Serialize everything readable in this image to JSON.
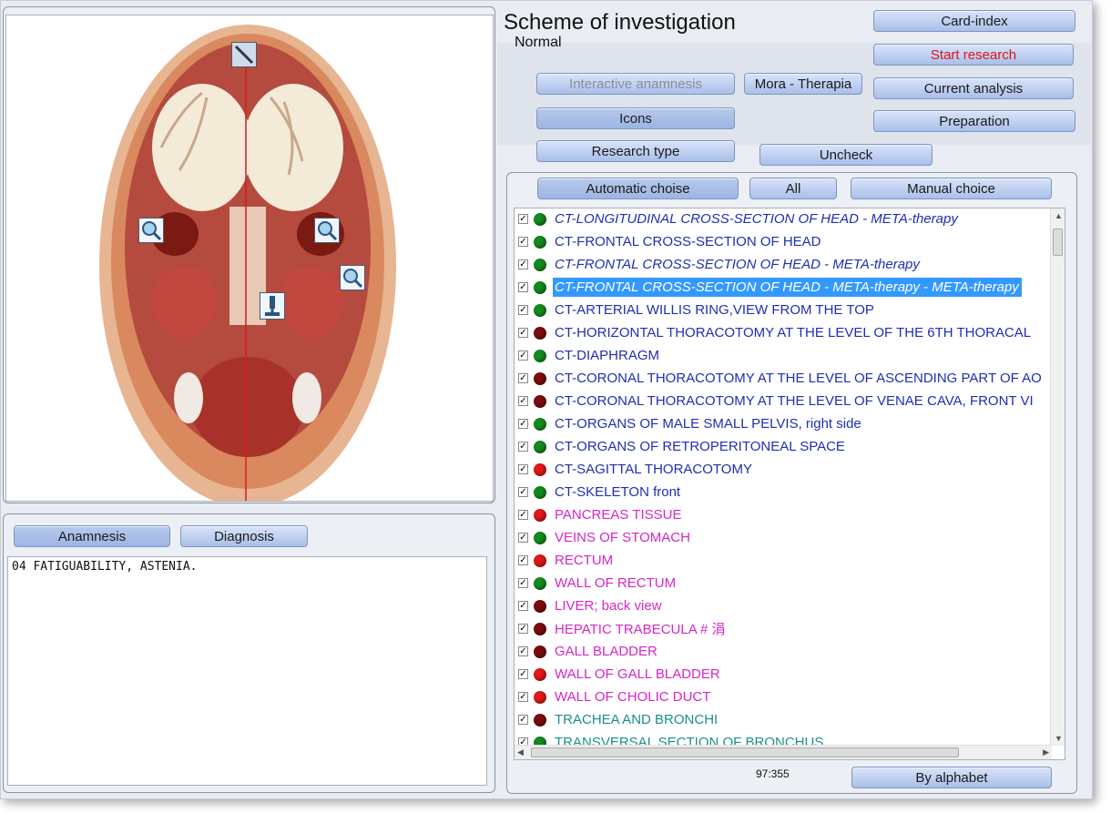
{
  "header": {
    "title": "Scheme of investigation",
    "subtitle": "Normal"
  },
  "buttons": {
    "card_index": "Card-index",
    "start_research": "Start research",
    "current_analysis": "Current analysis",
    "preparation": "Preparation",
    "interactive_anamnesis": "Interactive anamnesis",
    "mora_therapia": "Mora - Therapia",
    "icons": "Icons",
    "research_type": "Research type",
    "uncheck": "Uncheck",
    "automatic_choise": "Automatic choise",
    "all": "All",
    "manual_choice": "Manual choice",
    "by_alphabet": "By alphabet",
    "anamnesis": "Anamnesis",
    "diagnosis": "Diagnosis"
  },
  "counter": "97:355",
  "anamnesis_text": "04  FATIGUABILITY, ASTENIA.",
  "colors": {
    "green": "#138a1d",
    "darkred": "#7a0d0d",
    "red": "#e01818",
    "blue": "#1f2fb0",
    "magenta": "#d626c8",
    "teal": "#1a8f8a"
  },
  "list": [
    {
      "label": "CT-LONGITUDINAL CROSS-SECTION OF HEAD - META-therapy",
      "dot": "green",
      "color": "blue",
      "italic": true
    },
    {
      "label": "CT-FRONTAL CROSS-SECTION OF HEAD",
      "dot": "green",
      "color": "blue",
      "italic": false
    },
    {
      "label": "CT-FRONTAL CROSS-SECTION OF HEAD - META-therapy",
      "dot": "green",
      "color": "blue",
      "italic": true
    },
    {
      "label": "CT-FRONTAL CROSS-SECTION OF HEAD - META-therapy - META-therapy",
      "dot": "green",
      "color": "blue",
      "italic": true,
      "selected": true
    },
    {
      "label": "CT-ARTERIAL WILLIS RING,VIEW FROM THE TOP",
      "dot": "green",
      "color": "blue",
      "italic": false
    },
    {
      "label": "CT-HORIZONTAL THORACOTOMY AT THE LEVEL OF THE 6TH THORACAL",
      "dot": "darkred",
      "color": "blue",
      "italic": false
    },
    {
      "label": "CT-DIAPHRAGM",
      "dot": "green",
      "color": "blue",
      "italic": false
    },
    {
      "label": "CT-CORONAL THORACOTOMY AT THE LEVEL OF ASCENDING PART OF AO",
      "dot": "darkred",
      "color": "blue",
      "italic": false
    },
    {
      "label": "CT-CORONAL THORACOTOMY AT THE LEVEL OF VENAE CAVA, FRONT VI",
      "dot": "darkred",
      "color": "blue",
      "italic": false
    },
    {
      "label": "CT-ORGANS OF MALE SMALL PELVIS, right side",
      "dot": "green",
      "color": "blue",
      "italic": false
    },
    {
      "label": "CT-ORGANS OF RETROPERITONEAL SPACE",
      "dot": "green",
      "color": "blue",
      "italic": false
    },
    {
      "label": "CT-SAGITTAL THORACOTOMY",
      "dot": "red",
      "color": "blue",
      "italic": false
    },
    {
      "label": "CT-SKELETON front",
      "dot": "green",
      "color": "blue",
      "italic": false
    },
    {
      "label": "PANCREAS  TISSUE",
      "dot": "red",
      "color": "magenta",
      "italic": false
    },
    {
      "label": "VEINS OF STOMACH",
      "dot": "green",
      "color": "magenta",
      "italic": false
    },
    {
      "label": "RECTUM",
      "dot": "red",
      "color": "magenta",
      "italic": false
    },
    {
      "label": "WALL  OF  RECTUM",
      "dot": "green",
      "color": "magenta",
      "italic": false
    },
    {
      "label": "LIVER; back view",
      "dot": "darkred",
      "color": "magenta",
      "italic": false
    },
    {
      "label": "HEPATIC TRABECULA # 涓",
      "dot": "darkred",
      "color": "magenta",
      "italic": false
    },
    {
      "label": "GALL BLADDER",
      "dot": "darkred",
      "color": "magenta",
      "italic": false
    },
    {
      "label": "WALL OF GALL BLADDER",
      "dot": "red",
      "color": "magenta",
      "italic": false
    },
    {
      "label": "WALL OF CHOLIC DUCT",
      "dot": "red",
      "color": "magenta",
      "italic": false
    },
    {
      "label": "TRACHEA  AND  BRONCHI",
      "dot": "darkred",
      "color": "teal",
      "italic": false
    },
    {
      "label": "TRANSVERSAL SECTION OF BRONCHUS",
      "dot": "green",
      "color": "teal",
      "italic": false
    }
  ]
}
